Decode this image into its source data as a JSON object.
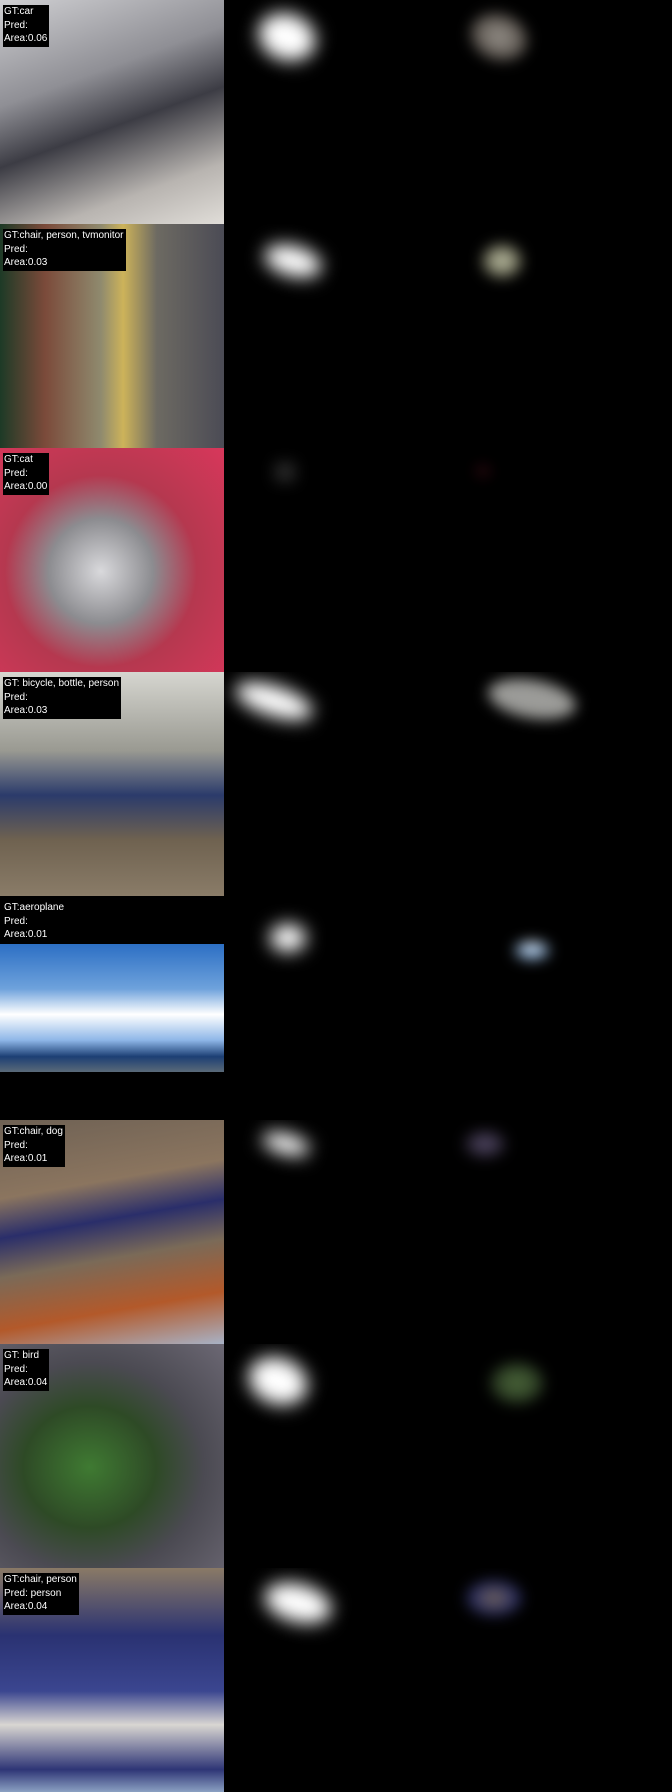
{
  "rows": [
    {
      "gt": "GT:car",
      "pred": "Pred:",
      "area": "Area:0.06",
      "photo_color": "#8d8d93"
    },
    {
      "gt": "GT:chair, person, tvmonitor",
      "pred": "Pred:",
      "area": "Area:0.03",
      "photo_color": "#6b6a60"
    },
    {
      "gt": "GT:cat",
      "pred": "Pred:",
      "area": "Area:0.00",
      "photo_color": "#b53b55"
    },
    {
      "gt": "GT: bicycle, bottle, person",
      "pred": "Pred:",
      "area": "Area:0.03",
      "photo_color": "#7f7668"
    },
    {
      "gt": "GT:aeroplane",
      "pred": "Pred:",
      "area": "Area:0.01",
      "photo_color": "#4a7fc3"
    },
    {
      "gt": "GT:chair, dog",
      "pred": "Pred:",
      "area": "Area:0.01",
      "photo_color": "#6a5646"
    },
    {
      "gt": "GT: bird",
      "pred": "Pred:",
      "area": "Area:0.04",
      "photo_color": "#46573a"
    },
    {
      "gt": "GT:chair, person",
      "pred": "Pred: person",
      "area": "Area:0.04",
      "photo_color": "#33385a"
    }
  ]
}
